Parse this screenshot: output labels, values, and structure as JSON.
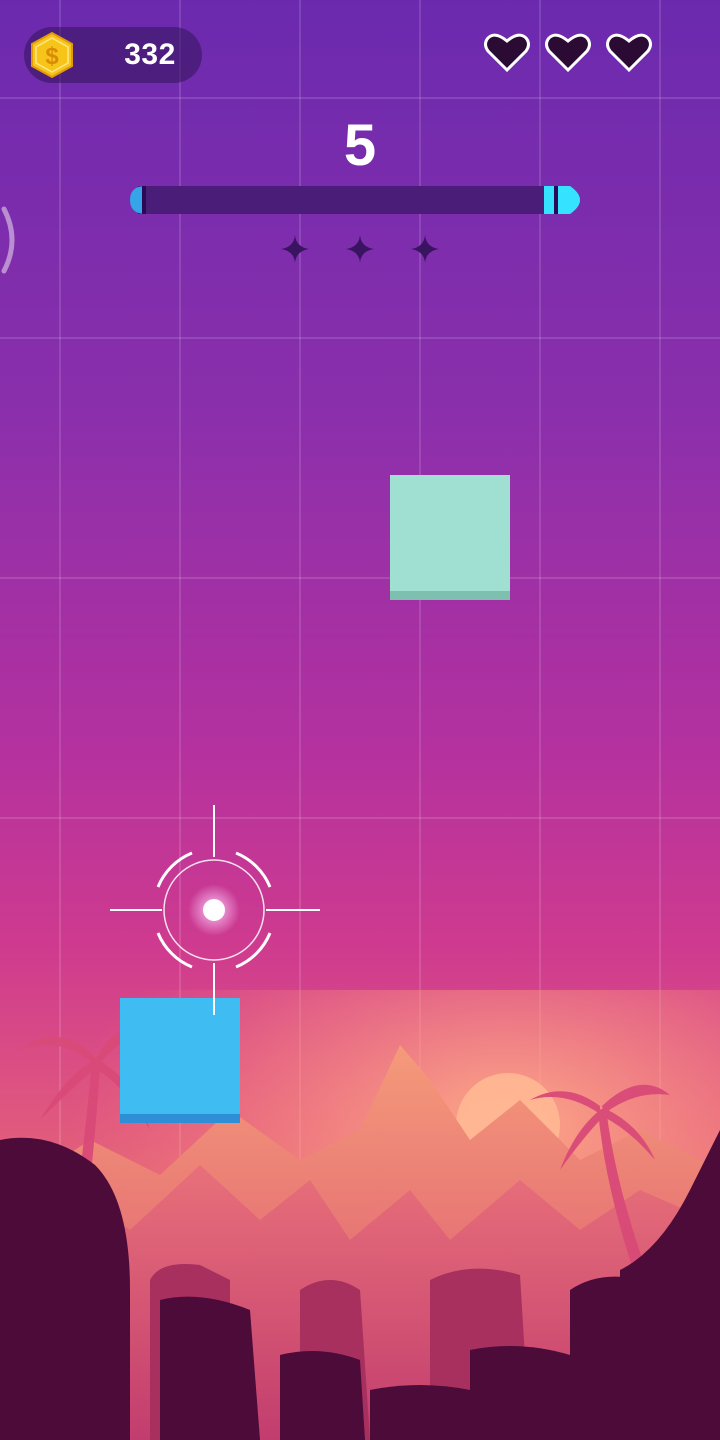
{
  "hud": {
    "coins": "332",
    "coin_icon": "dollar-coin-icon",
    "lives_total": 3,
    "lives_icon": "heart-icon",
    "score": "5",
    "progress_fraction": 0.0,
    "stars_earned": 0,
    "stars_total": 3
  },
  "colors": {
    "coin_gold": "#f7c51a",
    "heart_dark": "#2b0a33",
    "progress_track": "#4a1d78",
    "progress_accent": "#35e2ff",
    "tile_mint": "#9fe0d3",
    "tile_blue": "#3fbcf2",
    "silhouette": "#4d0b3a"
  },
  "tiles": [
    {
      "color": "mint"
    },
    {
      "color": "blue"
    }
  ]
}
